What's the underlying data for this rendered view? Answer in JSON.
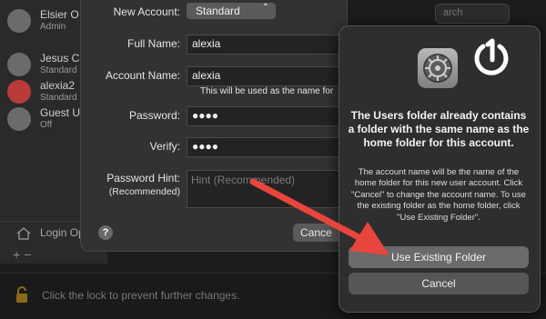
{
  "background": {
    "users": [
      {
        "name": "Elsier O",
        "role": "Admin"
      },
      {
        "name": "Jesus C",
        "role": "Standard"
      },
      {
        "name": "alexia2",
        "role": "Standard"
      },
      {
        "name": "Guest U",
        "role": "Off"
      }
    ],
    "login_options": "Login Op",
    "plus_minus": "+   −",
    "lock_text": "Click the lock to prevent further changes.",
    "search_placeholder": "arch"
  },
  "new_account_sheet": {
    "new_account_label": "New Account:",
    "account_type": "Standard",
    "full_name_label": "Full Name:",
    "full_name_value": "alexia",
    "account_name_label": "Account Name:",
    "account_name_value": "alexia",
    "account_name_note": "This will be used as the name for",
    "password_label": "Password:",
    "password_value": "●●●●",
    "verify_label": "Verify:",
    "verify_value": "●●●●",
    "hint_label_1": "Password Hint:",
    "hint_label_2": "(Recommended)",
    "hint_placeholder": "Hint (Recommended)",
    "help": "?",
    "cancel": "Cance"
  },
  "alert": {
    "title": "The Users folder already contains a folder with the same name as the home folder for this account.",
    "message": "The account name will be the name of the home folder for this new user account. Click \"Cancel\" to change the account name. To use the existing folder as the home folder, click \"Use Existing Folder\".",
    "primary_button": "Use Existing Folder",
    "cancel_button": "Cancel"
  },
  "colors": {
    "arrow": "#e8453c",
    "sheet_bg": "#323232",
    "alert_bg": "#2e2e2e"
  }
}
